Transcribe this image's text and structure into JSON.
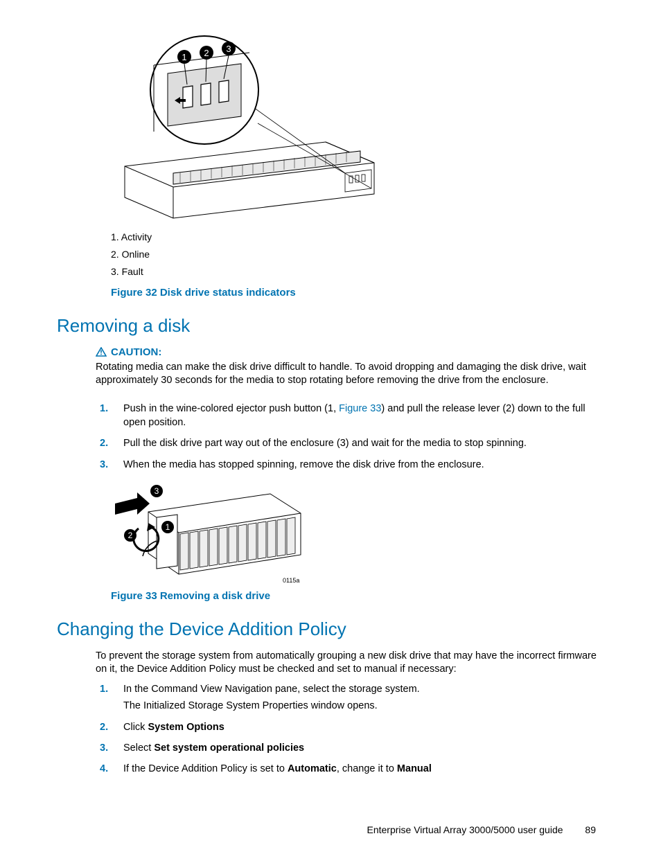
{
  "legend": {
    "items": [
      "Activity",
      "Online",
      "Fault"
    ]
  },
  "figure32_caption": "Figure 32 Disk drive status indicators",
  "section_removing": "Removing a disk",
  "caution": {
    "label": "CAUTION:",
    "body": "Rotating media can make the disk drive difficult to handle. To avoid dropping and damaging the disk drive, wait approximately 30 seconds for the media to stop rotating before removing the drive from the enclosure."
  },
  "steps_removing": {
    "s1_a": "Push in the wine-colored ejector push button (1, ",
    "s1_link": "Figure 33",
    "s1_b": ") and pull the release lever (2) down to the full open position.",
    "s2": "Pull the disk drive part way out of the enclosure (3) and wait for the media to stop spinning.",
    "s3": "When the media has stopped spinning, remove the disk drive from the enclosure."
  },
  "figure33_id": "0115a",
  "figure33_caption": "Figure 33 Removing a disk drive",
  "section_policy": "Changing the Device Addition Policy",
  "policy_intro": "To prevent the storage system from automatically grouping a new disk drive that may have the incorrect firmware on it, the Device Addition Policy must be checked and set to manual if necessary:",
  "steps_policy": {
    "s1a": "In the Command View Navigation pane, select the storage system.",
    "s1b": "The Initialized Storage System Properties window opens.",
    "s2_pre": "Click ",
    "s2_bold": "System Options",
    "s3_pre": "Select ",
    "s3_bold": "Set system operational policies",
    "s4_a": "If the Device Addition Policy is set to ",
    "s4_b1": "Automatic",
    "s4_mid": ", change it to ",
    "s4_b2": "Manual"
  },
  "footer": {
    "title": "Enterprise Virtual Array 3000/5000 user guide",
    "page": "89"
  }
}
